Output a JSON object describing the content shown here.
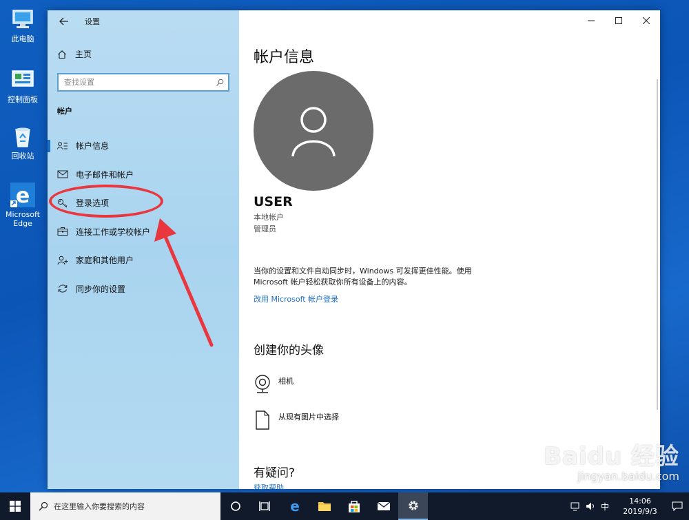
{
  "desktop": {
    "icons": [
      {
        "label": "此电脑",
        "icon": "computer-icon"
      },
      {
        "label": "控制面板",
        "icon": "control-panel-icon"
      },
      {
        "label": "回收站",
        "icon": "recycle-bin-icon"
      },
      {
        "label": "Microsoft Edge",
        "icon": "edge-icon"
      }
    ]
  },
  "window": {
    "title": "设置",
    "controls": {
      "minimize": "minimize-icon",
      "maximize": "maximize-icon",
      "close": "close-icon"
    }
  },
  "sidebar": {
    "home_label": "主页",
    "search_placeholder": "查找设置",
    "section_label": "帐户",
    "items": [
      {
        "label": "帐户信息",
        "icon": "account-info-icon",
        "active": true
      },
      {
        "label": "电子邮件和帐户",
        "icon": "mail-icon",
        "active": false
      },
      {
        "label": "登录选项",
        "icon": "key-icon",
        "active": false
      },
      {
        "label": "连接工作或学校帐户",
        "icon": "briefcase-icon",
        "active": false
      },
      {
        "label": "家庭和其他用户",
        "icon": "add-user-icon",
        "active": false
      },
      {
        "label": "同步你的设置",
        "icon": "sync-icon",
        "active": false
      }
    ]
  },
  "main": {
    "title": "帐户信息",
    "user": {
      "name": "USER",
      "type": "本地帐户",
      "role": "管理员"
    },
    "sync_text": "当你的设置和文件自动同步时，Windows 可发挥更佳性能。使用 Microsoft 帐户轻松获取你所有设备上的内容。",
    "sync_link": "改用 Microsoft 帐户登录",
    "avatar_heading": "创建你的头像",
    "avatar_options": [
      {
        "label": "相机",
        "icon": "camera-icon"
      },
      {
        "label": "从现有图片中选择",
        "icon": "picture-file-icon"
      }
    ],
    "faq_heading": "有疑问?",
    "faq_link": "获取帮助"
  },
  "taskbar": {
    "search_placeholder": "在这里输入你要搜索的内容",
    "ime": "中",
    "time": "14:06",
    "date": "2019/9/3"
  },
  "watermark": {
    "logo": "Baidu 经验",
    "url": "jingyan.baidu.com"
  },
  "colors": {
    "accent": "#1a6fc9",
    "annotation": "#e8373e",
    "sidebar_bg": "#b1d8f0",
    "taskbar_bg": "#101a2a"
  }
}
